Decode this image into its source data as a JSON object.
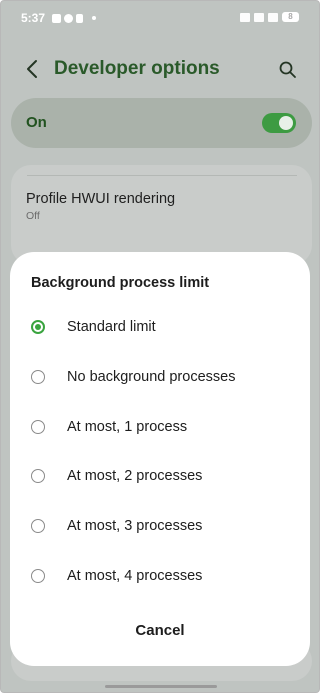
{
  "status_bar": {
    "time": "5:37",
    "battery": "8"
  },
  "app_bar": {
    "title": "Developer options"
  },
  "master_switch": {
    "label": "On",
    "state": "on",
    "accent": "#3d9b42"
  },
  "settings_list": {
    "items": [
      {
        "title": "Profile HWUI rendering",
        "subtitle": "Off"
      }
    ]
  },
  "dialog": {
    "title": "Background process limit",
    "selected_index": 0,
    "accent": "#3aa43f",
    "options": [
      {
        "label": "Standard limit"
      },
      {
        "label": "No background processes"
      },
      {
        "label": "At most, 1 process"
      },
      {
        "label": "At most, 2 processes"
      },
      {
        "label": "At most, 3 processes"
      },
      {
        "label": "At most, 4 processes"
      }
    ],
    "cancel_label": "Cancel"
  }
}
